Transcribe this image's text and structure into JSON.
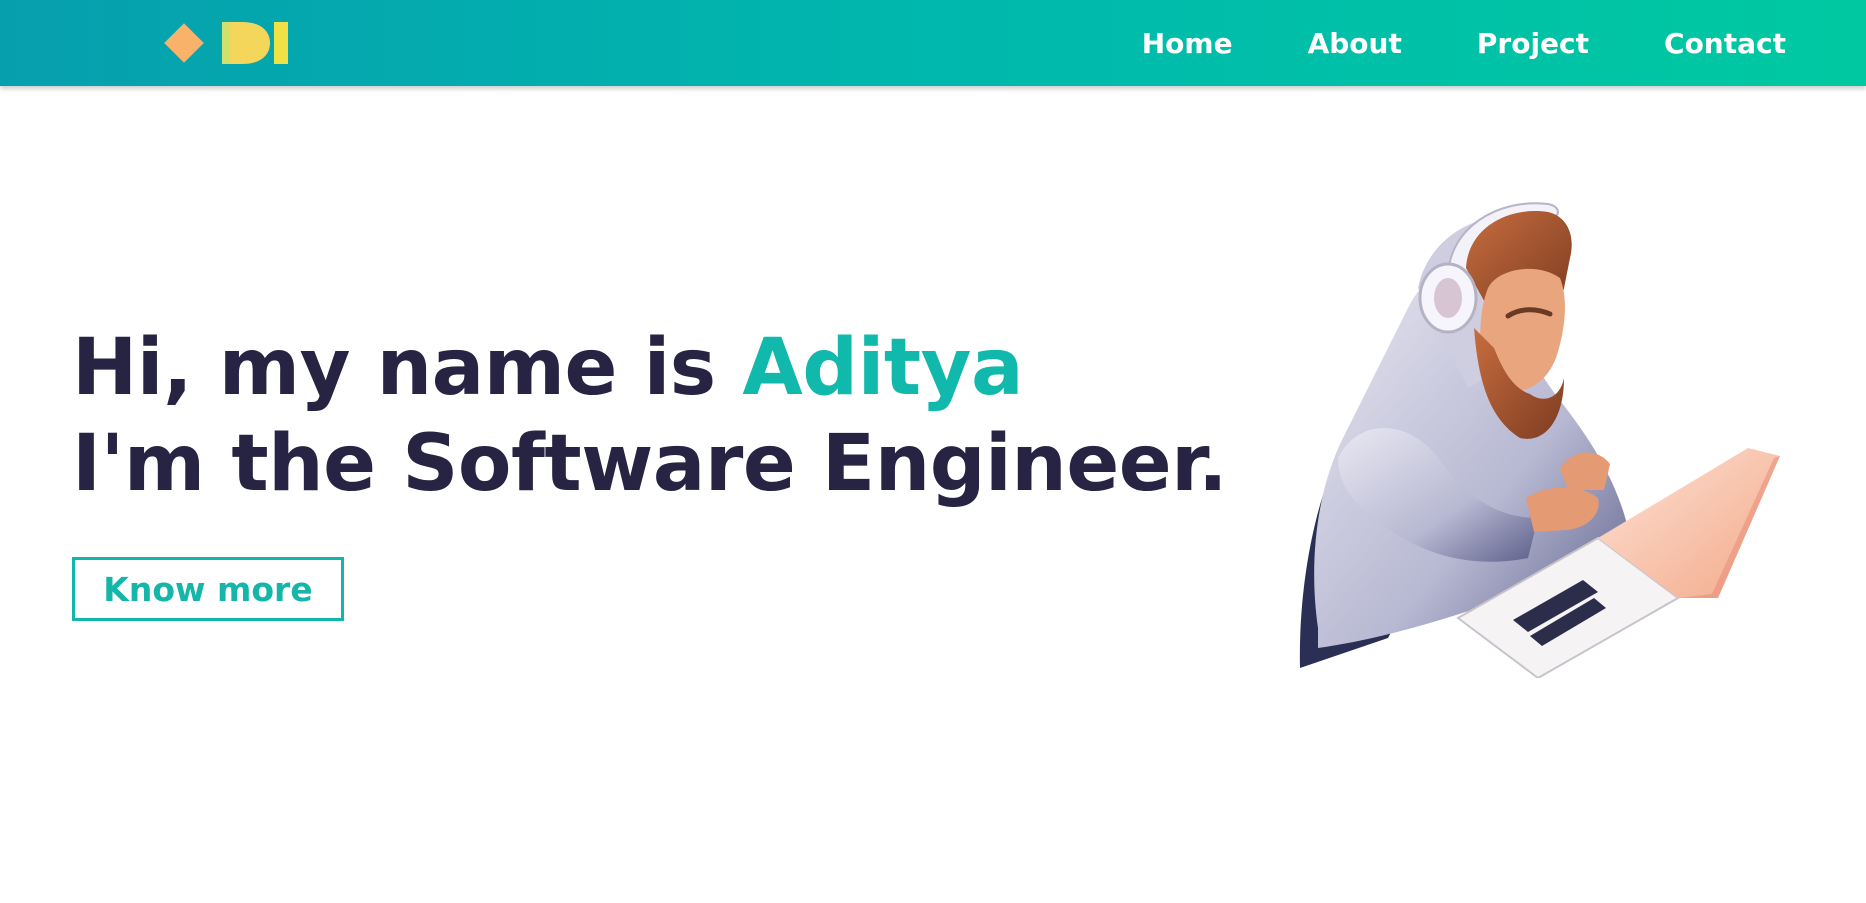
{
  "navbar": {
    "logo_text": "ADI",
    "links": [
      {
        "label": "Home"
      },
      {
        "label": "About"
      },
      {
        "label": "Project"
      },
      {
        "label": "Contact"
      }
    ]
  },
  "hero": {
    "line1_prefix": "Hi, my name is ",
    "name": "Aditya",
    "line2": "I'm the Software Engineer.",
    "button_label": "Know more"
  },
  "colors": {
    "accent": "#11b8ac",
    "heading": "#272343",
    "navbar_gradient_start": "#069fae",
    "navbar_gradient_end": "#00c9a1"
  },
  "icons": {
    "logo": "adi-logo-icon",
    "illustration": "developer-with-laptop-illustration"
  }
}
